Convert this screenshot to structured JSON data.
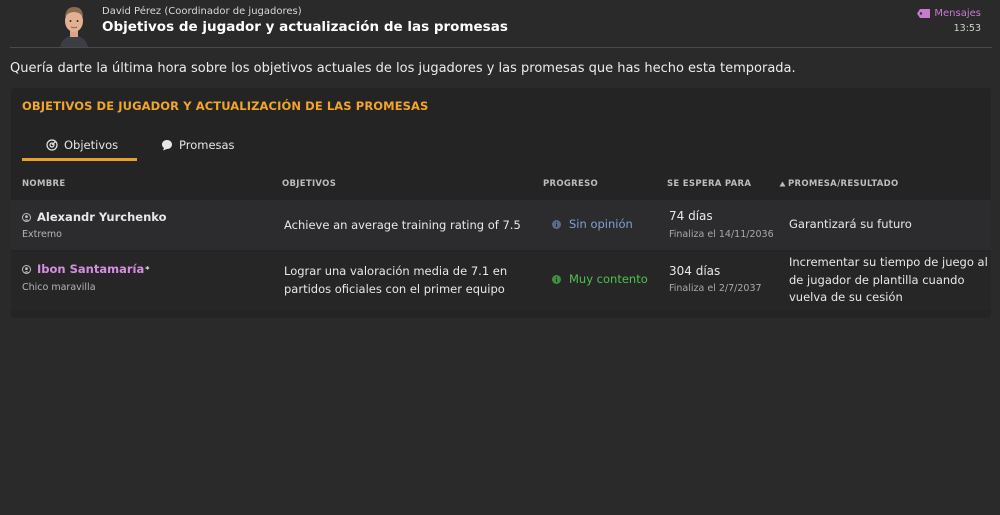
{
  "header": {
    "sender": "David Pérez  (Coordinador de jugadores)",
    "subject": "Objetivos de jugador y actualización de las promesas",
    "mensajes_label": "Mensajes",
    "time": "13:53"
  },
  "intro": "Quería darte la última hora sobre los objetivos actuales de los jugadores y las promesas que has hecho esta temporada.",
  "panel": {
    "title": "OBJETIVOS DE JUGADOR Y ACTUALIZACIÓN DE LAS PROMESAS",
    "tabs": [
      {
        "label": "Objetivos",
        "icon": "target-icon",
        "active": true
      },
      {
        "label": "Promesas",
        "icon": "speech-bubble-icon",
        "active": false
      }
    ],
    "columns": {
      "nombre": "NOMBRE",
      "objetivos": "OBJETIVOS",
      "progreso": "PROGRESO",
      "se_espera": "SE ESPERA PARA",
      "promesa": "PROMESA/RESULTADO"
    },
    "rows": [
      {
        "name": "Alexandr Yurchenko",
        "role": "Extremo",
        "objective": "Achieve an average training rating of 7.5",
        "progress": "Sin opinión",
        "progress_color": "#7f9fd6",
        "days": "74 días",
        "finaliza": "Finaliza el 14/11/2036",
        "promise": "Garantizará su futuro"
      },
      {
        "name": "Ibon Santamaría",
        "name_mark": "*",
        "role": "Chico maravilla",
        "objective_line1": "Lograr una valoración media de 7.1 en",
        "objective_line2": "partidos oficiales con el primer equipo",
        "progress": "Muy contento",
        "progress_color": "#4fc14f",
        "days": "304 días",
        "finaliza": "Finaliza el 2/7/2037",
        "promise_line1": "Incrementar su tiempo de juego al",
        "promise_line2": "de jugador de plantilla cuando",
        "promise_line3": "vuelva de su cesión"
      }
    ]
  },
  "colors": {
    "accent": "#e8a02d",
    "title_orange": "#f2a52b",
    "highlight_purple": "#d58fe0",
    "background": "#2a2a2b"
  }
}
